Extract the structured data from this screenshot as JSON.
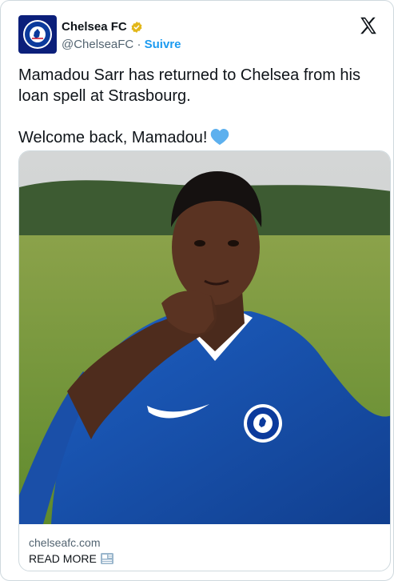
{
  "author": {
    "name": "Chelsea FC",
    "handle": "@ChelseaFC",
    "separator": "·",
    "follow_label": "Suivre",
    "avatar_icon": "chelsea-crest-icon",
    "verified_icon": "gold-verified-badge-icon",
    "verified_color": "#e2b719"
  },
  "platform_icon": "x-logo-icon",
  "tweet": {
    "line1": "Mamadou Sarr has returned to Chelsea from his loan spell at Strasbourg.",
    "line2": "Welcome back, Mamadou!",
    "emoji": "blue-heart-icon"
  },
  "link_card": {
    "domain": "chelseafc.com",
    "read_more": "READ MORE",
    "read_more_icon": "newspaper-icon",
    "photo_description_icon": "player-photo"
  },
  "colors": {
    "link_blue": "#1d9bf0",
    "chelsea_blue": "#034694",
    "muted": "#536471",
    "border": "#cfd9de"
  }
}
